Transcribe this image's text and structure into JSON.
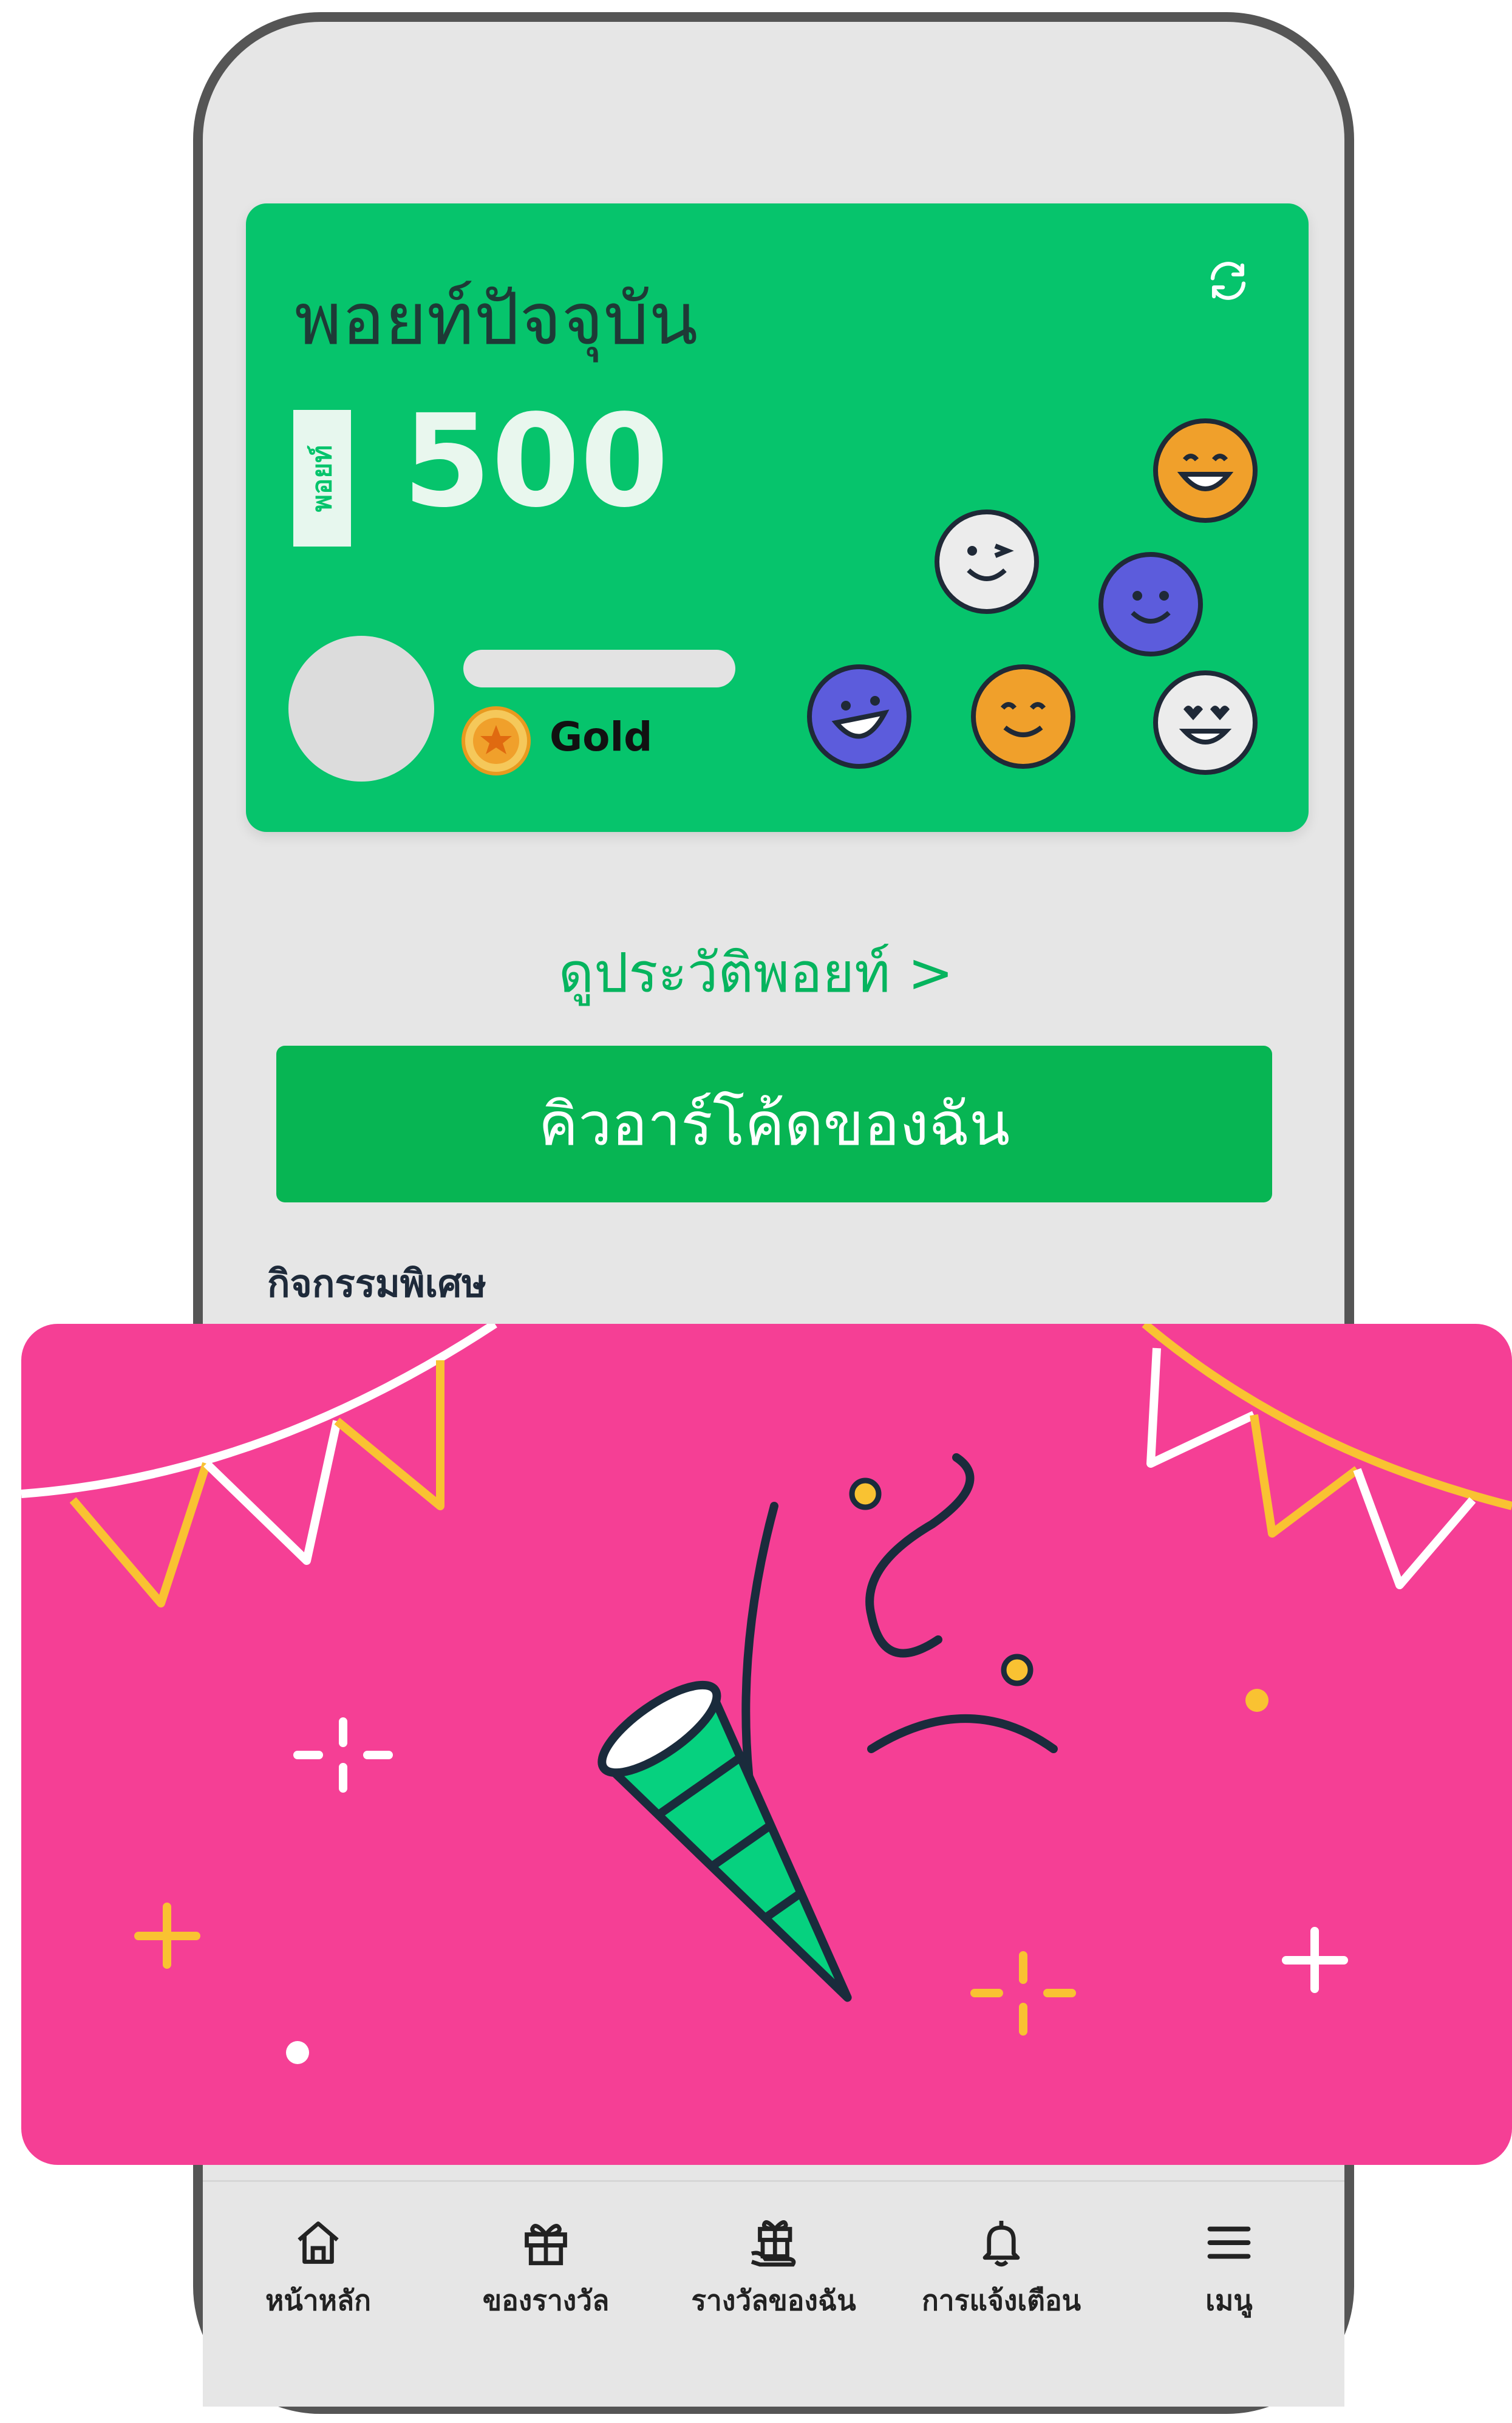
{
  "points_card": {
    "title": "พอยท์ปัจจุบัน",
    "points_tag": "พอยท์",
    "points_value": "500",
    "tier": "Gold"
  },
  "history_link": "ดูประวัติพอยท์ >",
  "qr_button": "คิวอาร์โค้ดของฉัน",
  "section_title": "กิจกรรมพิเศษ",
  "nav": [
    {
      "label": "หน้าหลัก",
      "icon": "home-icon"
    },
    {
      "label": "ของรางวัล",
      "icon": "gift-icon"
    },
    {
      "label": "รางวัลของฉัน",
      "icon": "my-rewards-icon"
    },
    {
      "label": "การแจ้งเตือน",
      "icon": "bell-icon"
    },
    {
      "label": "เมนู",
      "icon": "menu-icon"
    }
  ],
  "colors": {
    "brand_green": "#06c46c",
    "button_green": "#07b553",
    "banner_pink": "#f53f95",
    "gold": "#f0a02b",
    "face_purple": "#5c5cdc",
    "face_orange": "#f0a02b"
  }
}
